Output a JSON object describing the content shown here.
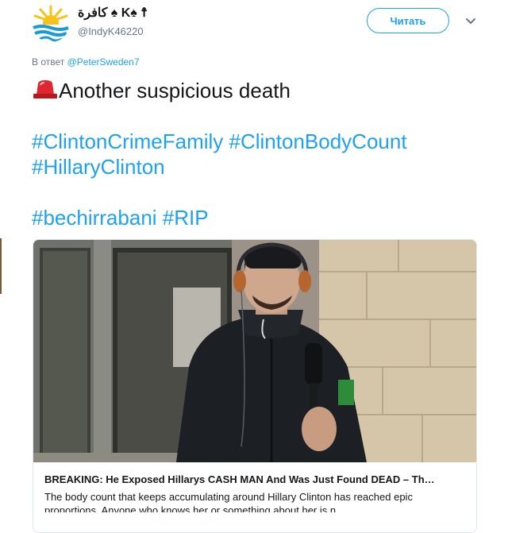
{
  "author": {
    "display_name": "كافرة ♠ K♠ ☨",
    "handle": "@IndyK46220",
    "avatar_icon": "sunrise-over-sea-avatar"
  },
  "follow_button": {
    "label": "Читать"
  },
  "reply": {
    "prefix": "В ответ",
    "mention": "@PeterSweden7"
  },
  "tweet": {
    "emoji_icon": "police-siren-icon",
    "line1": "Another suspicious death",
    "hashtags_line2": [
      "#ClintonCrimeFamily",
      "#ClintonBodyCount"
    ],
    "hashtags_line3": [
      "#HillaryClinton"
    ],
    "hashtags_line4": [
      "#bechirrabani",
      "#RIP"
    ]
  },
  "card": {
    "title": "BREAKING: He Exposed Hillarys CASH MAN And Was Just Found DEAD – Th…",
    "description": "The body count that keeps accumulating around Hillary Clinton has reached epic proportions. Anyone who knows her or something about her is n…"
  },
  "colors": {
    "accent": "#1da1f2",
    "text": "#14171a",
    "muted": "#657786",
    "border": "#e1e8ed"
  }
}
